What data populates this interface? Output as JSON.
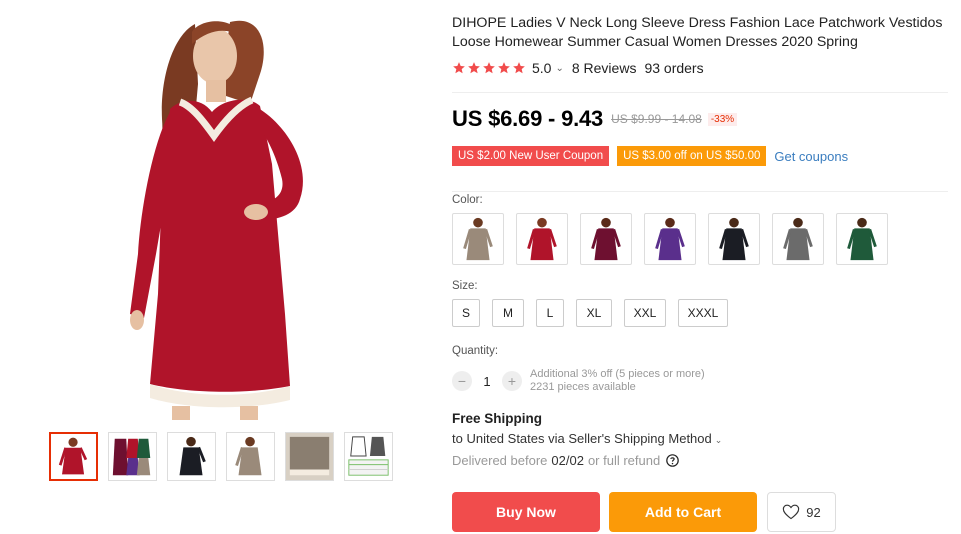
{
  "product": {
    "title": "DIHOPE Ladies V Neck Long Sleeve Dress Fashion Lace Patchwork Vestidos Loose Homewear Summer Casual Women Dresses 2020 Spring",
    "rating": "5.0",
    "stars": 5,
    "reviews": "8 Reviews",
    "orders": "93 orders",
    "price": "US $6.69 - 9.43",
    "old_price": "US $9.99 - 14.08",
    "discount": "-33%"
  },
  "coupons": {
    "new_user": "US $2.00 New User Coupon",
    "off_spend": "US $3.00 off on US $50.00",
    "get_coupons": "Get coupons"
  },
  "options": {
    "color_label": "Color:",
    "colors": [
      {
        "name": "khaki",
        "hex": "#9a8a7a"
      },
      {
        "name": "red",
        "hex": "#b0142a"
      },
      {
        "name": "wine",
        "hex": "#6e1030"
      },
      {
        "name": "purple",
        "hex": "#5a2f8c"
      },
      {
        "name": "black",
        "hex": "#1b1d24"
      },
      {
        "name": "gray",
        "hex": "#6b6b6b"
      },
      {
        "name": "green",
        "hex": "#1f5a3a"
      }
    ],
    "size_label": "Size:",
    "sizes": [
      "S",
      "M",
      "L",
      "XL",
      "XXL",
      "XXXL"
    ],
    "quantity_label": "Quantity:",
    "quantity": "1",
    "qty_note1": "Additional 3% off (5 pieces or more)",
    "qty_note2": "2231 pieces available"
  },
  "shipping": {
    "title": "Free Shipping",
    "destination": "to United States via Seller's Shipping Method",
    "eta_prefix": "Delivered before",
    "eta_date": "02/02",
    "eta_suffix": "or full refund"
  },
  "actions": {
    "buy_now": "Buy Now",
    "add_to_cart": "Add to Cart",
    "wishlist_count": "92"
  },
  "colors": {
    "accent_red": "#f14c4c",
    "accent_orange": "#fb9a08",
    "link_blue": "#3a7dbf",
    "star": "#f14c4c"
  }
}
